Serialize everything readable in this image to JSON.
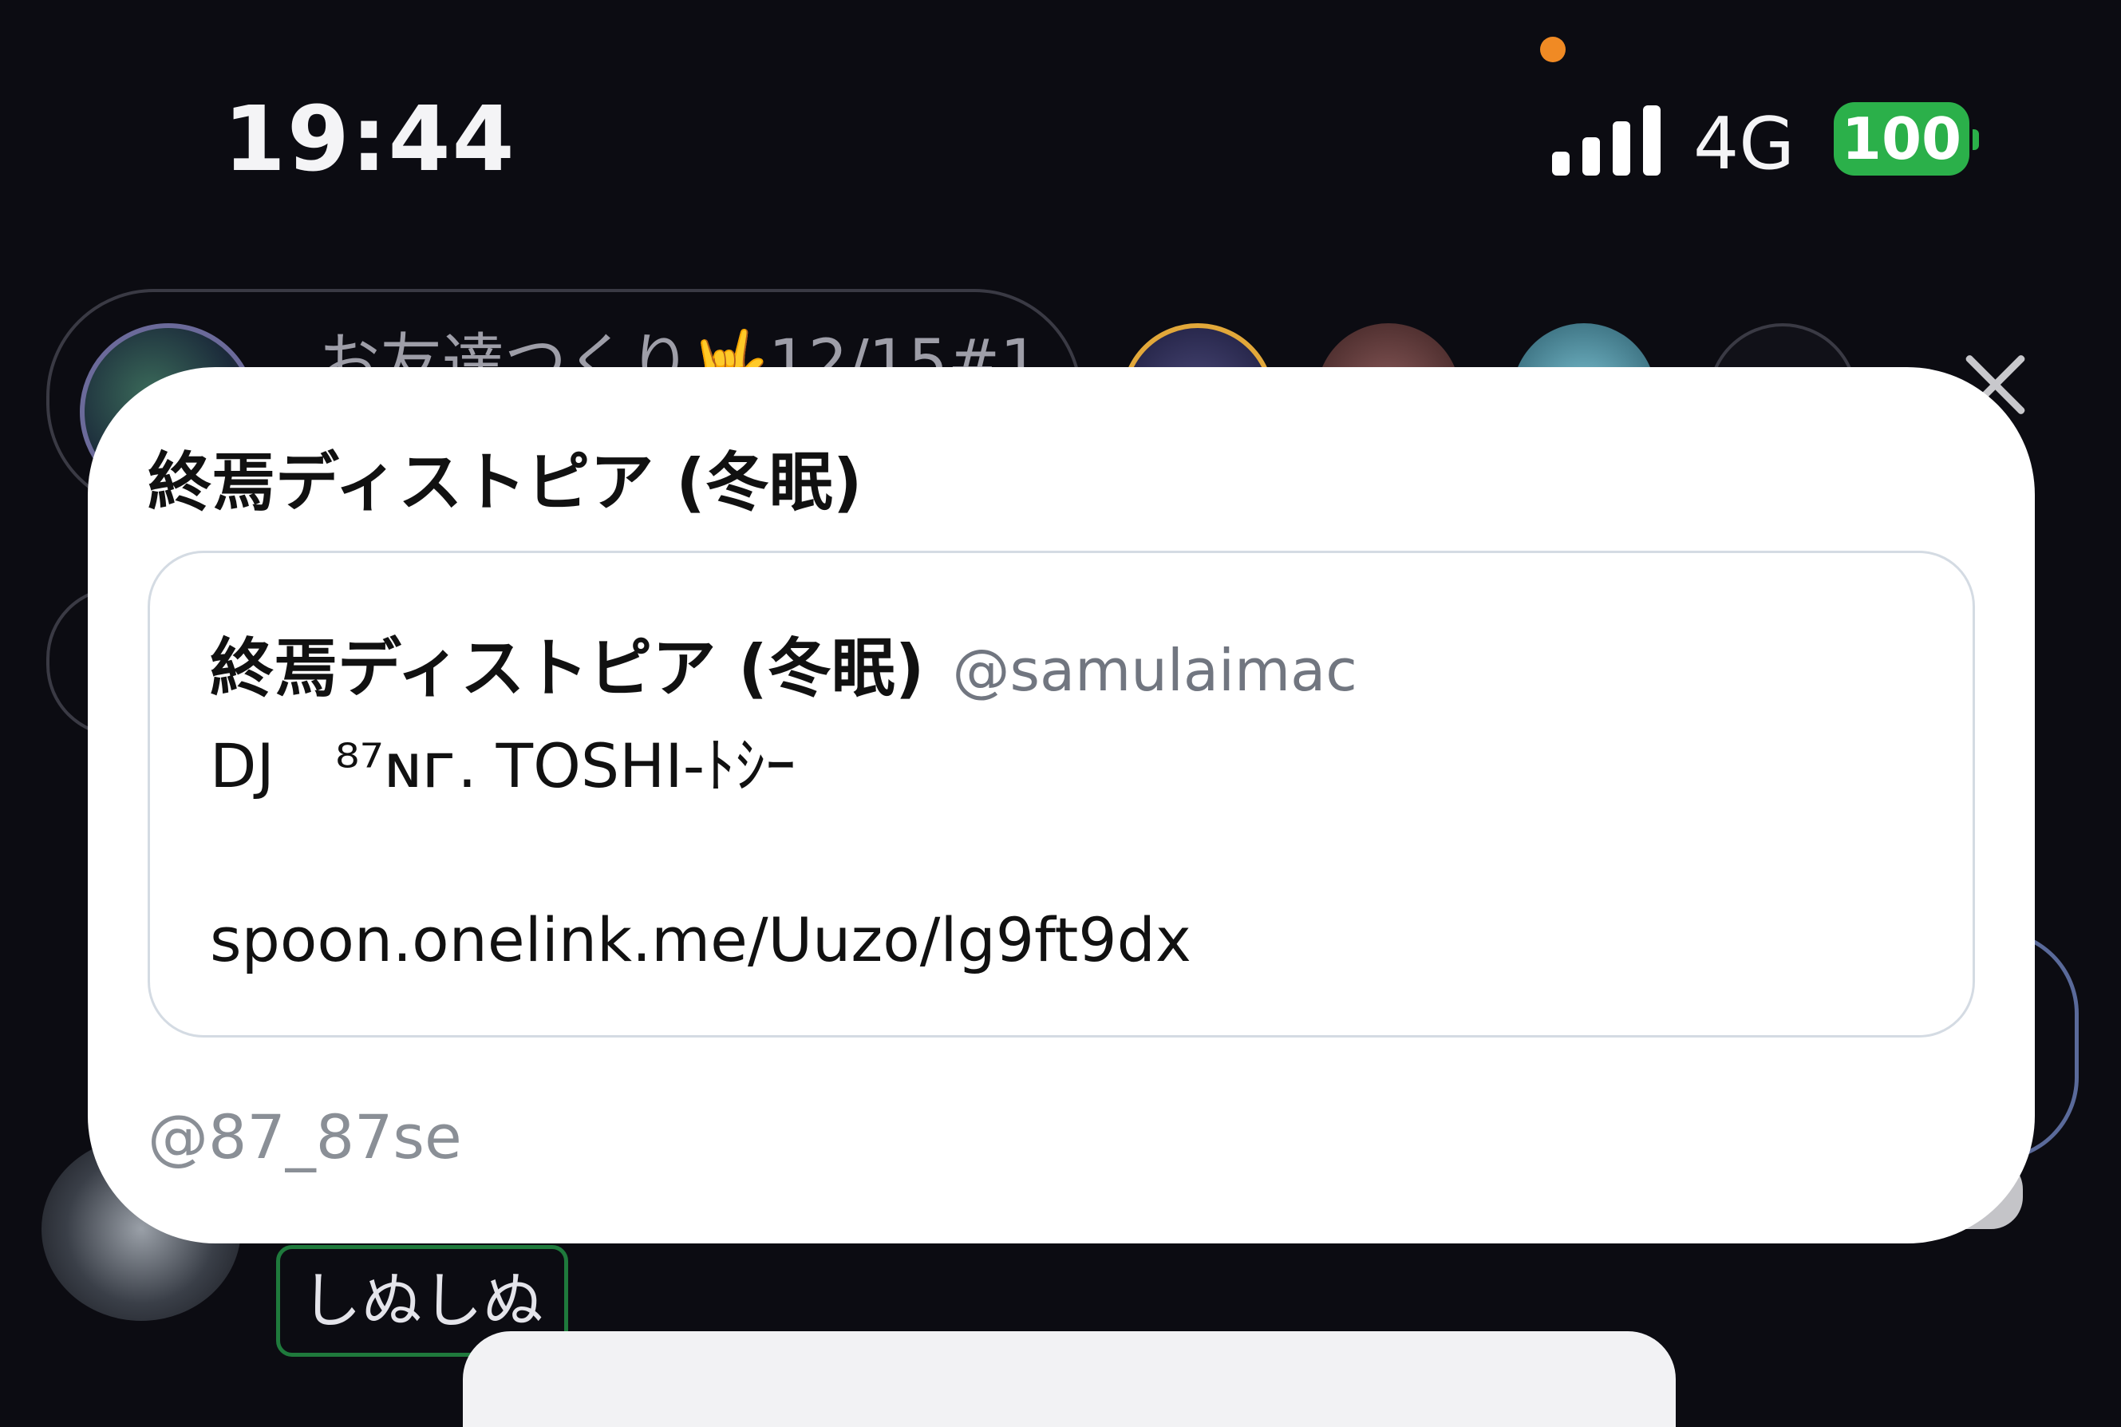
{
  "status_bar": {
    "time": "19:44",
    "network": "4G",
    "battery": "100",
    "battery_color": "#2bb04a",
    "recording_indicator_color": "#f08a24"
  },
  "background": {
    "room_title": "お友達つくり🤟12/15#1",
    "chip_label": "しぬしぬ"
  },
  "card": {
    "title": "終焉ディストピア (冬眠)",
    "quote": {
      "name": "終焉ディストピア (冬眠)",
      "handle": "@samulaimac",
      "line1": "DJ　⁸⁷ɴᴦ. TOSHI-ﾄｼｰ",
      "line2": "spoon.onelink.me/Uuzo/lg9ft9dx"
    },
    "footer_handle": "@87_87se"
  },
  "icons": {
    "close": "close-icon",
    "signal": "signal-icon"
  }
}
